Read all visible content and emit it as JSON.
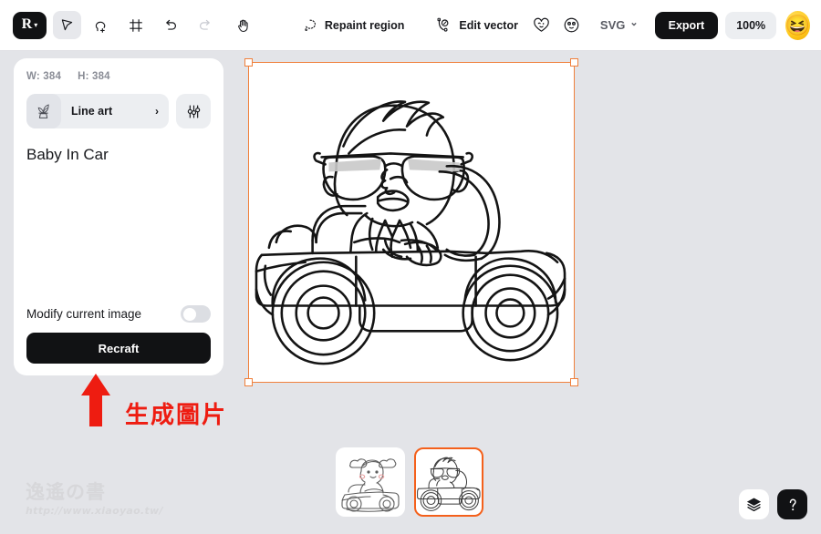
{
  "app": {
    "name": "Recraft",
    "logo_glyph": "R",
    "background_color": "#e3e4e8",
    "accent_color": "#f0803c",
    "selected_thumb_color": "#f4601b",
    "annotation_color": "#ee1c11"
  },
  "toolbar": {
    "logo_label": "R",
    "logo_chevron": "▾",
    "tools": [
      {
        "name": "select-tool",
        "title": "Select",
        "active": true
      },
      {
        "name": "lasso-tool",
        "title": "Lasso select",
        "active": false
      },
      {
        "name": "frame-tool",
        "title": "Frame",
        "active": false
      },
      {
        "name": "undo-tool",
        "title": "Undo",
        "active": false
      },
      {
        "name": "redo-tool",
        "title": "Redo",
        "active": false
      },
      {
        "name": "hand-tool",
        "title": "Hand",
        "active": false
      }
    ],
    "repaint_region_label": "Repaint region",
    "edit_vector_label": "Edit vector",
    "format_select": {
      "value": "SVG",
      "chevron": "⌄"
    },
    "export_label": "Export",
    "zoom_label": "100%",
    "avatar_emoji": "😆"
  },
  "side_panel": {
    "width_label": "W: 384",
    "height_label": "H: 384",
    "style": {
      "label": "Line art",
      "chevron": "›",
      "thumb_icon": "plant-icon"
    },
    "settings_icon": "sliders-icon",
    "prompt": "Baby In Car",
    "modify_label": "Modify current image",
    "modify_enabled": false,
    "recraft_label": "Recraft"
  },
  "annotation": {
    "text": "生成圖片",
    "arrow": "arrow-up-icon"
  },
  "watermark": {
    "logo_text": "逸遙の書",
    "url": "http://www.xiaoyao.tw/"
  },
  "canvas": {
    "artwork_title": "Baby In Car",
    "artwork_description": "Line art of a baby wearing sunglasses driving a convertible car",
    "selected": true,
    "handles": [
      "top-left",
      "top-right",
      "bottom-left",
      "bottom-right"
    ]
  },
  "thumbnails": [
    {
      "label": "Baby in car variation 1",
      "selected": false
    },
    {
      "label": "Baby in car variation 2",
      "selected": true
    }
  ],
  "bottom_right": {
    "layers_label": "Layers",
    "help_label": "?"
  }
}
